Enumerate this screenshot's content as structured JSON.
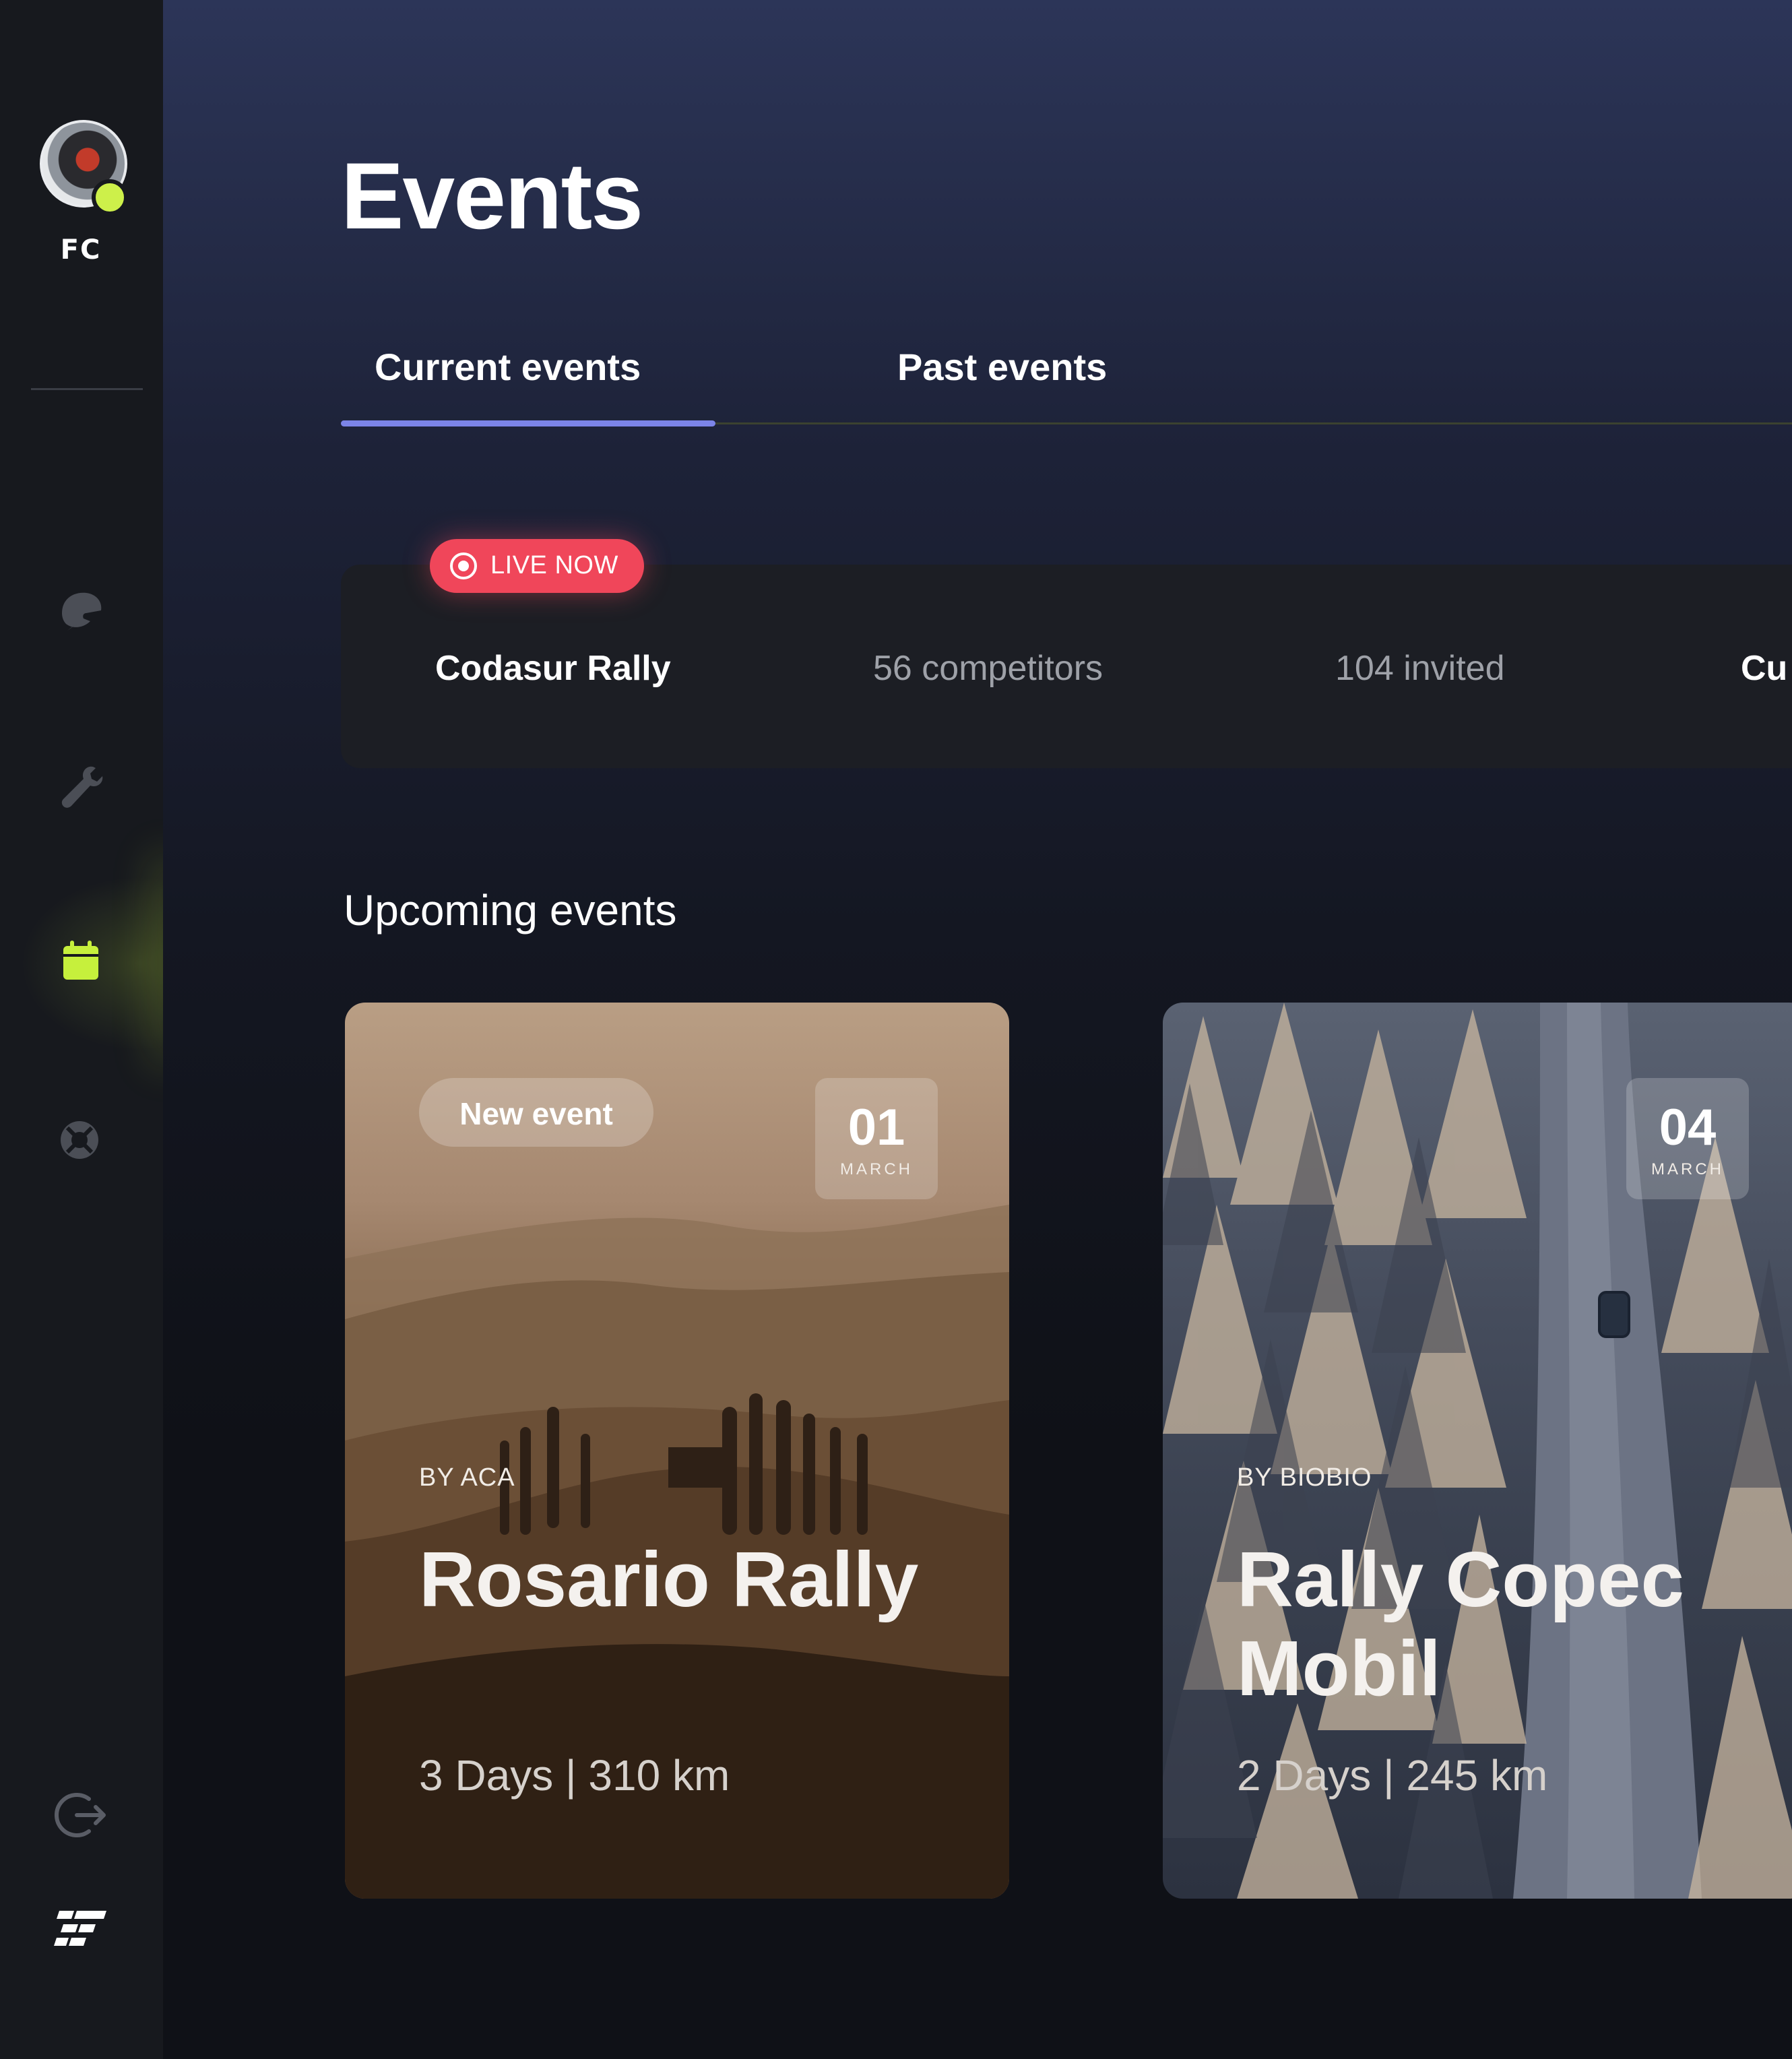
{
  "user": {
    "initials": "FC",
    "status_color": "#cdf04a"
  },
  "sidebar": {
    "items": [
      {
        "icon": "helmet-icon"
      },
      {
        "icon": "wrench-icon"
      },
      {
        "icon": "calendar-icon",
        "active": true
      },
      {
        "icon": "lifebuoy-icon"
      }
    ],
    "bottom": [
      {
        "icon": "logout-icon"
      },
      {
        "icon": "checkered-flag-logo"
      }
    ],
    "accent_color": "#c6f03c"
  },
  "page": {
    "title": "Events"
  },
  "tabs": [
    {
      "label": "Current events",
      "active": true
    },
    {
      "label": "Past events"
    }
  ],
  "live_event": {
    "badge": "LIVE NOW",
    "name": "Codasur Rally",
    "competitors": "56 competitors",
    "invited": "104 invited",
    "extra": "Cu"
  },
  "upcoming": {
    "title": "Upcoming events",
    "events": [
      {
        "badge": "New event",
        "day": "01",
        "month": "MARCH",
        "by": "BY ACA",
        "name": "Rosario Rally",
        "meta": "3 Days | 310 km"
      },
      {
        "day": "04",
        "month": "MARCH",
        "by": "BY BIOBIO",
        "name": "Rally Copec Mobil",
        "meta": "2 Days | 245 km"
      }
    ]
  },
  "colors": {
    "live_badge": "#f0465a",
    "tab_indicator": "#7c84e8"
  }
}
